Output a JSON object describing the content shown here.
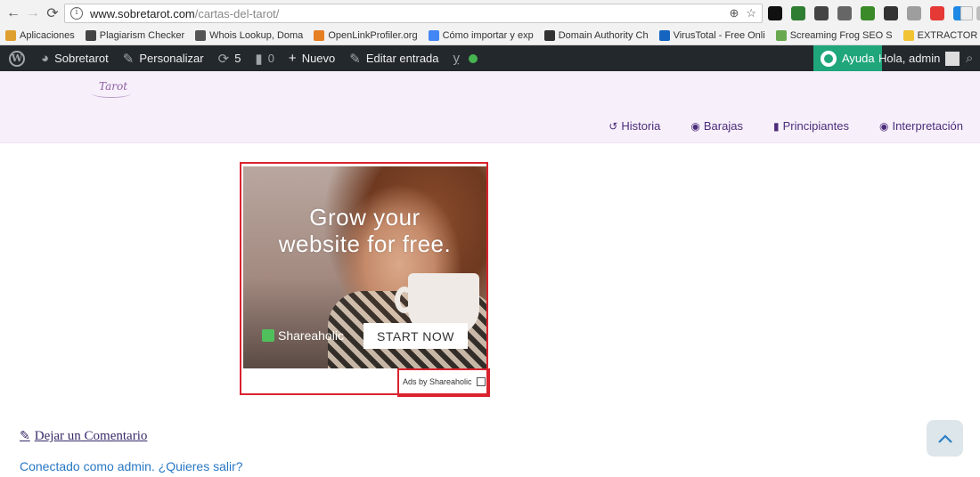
{
  "browser": {
    "url_host": "www.sobretarot.com",
    "url_path": "/cartas-del-tarot/",
    "extensions": [
      {
        "name": "ext-1",
        "color": "#111111"
      },
      {
        "name": "ext-2",
        "color": "#2e7d32"
      },
      {
        "name": "ext-3",
        "color": "#444444"
      },
      {
        "name": "ext-4",
        "color": "#666666"
      },
      {
        "name": "ext-5",
        "color": "#3b8a2a"
      },
      {
        "name": "ext-6",
        "color": "#333333"
      },
      {
        "name": "ext-7",
        "color": "#9e9e9e"
      },
      {
        "name": "ext-8",
        "color": "#e53935"
      },
      {
        "name": "ext-9",
        "color": "#1e88e5"
      },
      {
        "name": "ext-10",
        "color": "#bdbdbd"
      }
    ]
  },
  "bookmarks": [
    {
      "label": "Aplicaciones",
      "icon": "apps-icon",
      "color": "#e0a030"
    },
    {
      "label": "Plagiarism Checker",
      "icon": "plagiarism-icon",
      "color": "#444444"
    },
    {
      "label": "Whois Lookup, Doma",
      "icon": "whois-icon",
      "color": "#555555"
    },
    {
      "label": "OpenLinkProfiler.org",
      "icon": "openlink-icon",
      "color": "#e67e22"
    },
    {
      "label": "Cómo importar y exp",
      "icon": "google-icon",
      "color": "#4285f4"
    },
    {
      "label": "Domain Authority Ch",
      "icon": "domain-authority-icon",
      "color": "#333333"
    },
    {
      "label": "VirusTotal - Free Onli",
      "icon": "virustotal-icon",
      "color": "#1565c0"
    },
    {
      "label": "Screaming Frog SEO S",
      "icon": "frog-icon",
      "color": "#6aa84f"
    },
    {
      "label": "EXTRACTOR DE CORR",
      "icon": "warning-icon",
      "color": "#f1c232"
    }
  ],
  "adminbar": {
    "site": "Sobretarot",
    "customize": "Personalizar",
    "updates": "5",
    "comments": "0",
    "new": "Nuevo",
    "edit": "Editar entrada",
    "help": "Ayuda",
    "greeting": "Hola, admin"
  },
  "site": {
    "logo_text": "Tarot",
    "nav": [
      {
        "label": "Historia",
        "icon": "history-icon",
        "glyph": "↺"
      },
      {
        "label": "Barajas",
        "icon": "globe-icon",
        "glyph": "◉"
      },
      {
        "label": "Principiantes",
        "icon": "book-icon",
        "glyph": "▮"
      },
      {
        "label": "Interpretación",
        "icon": "eye-icon",
        "glyph": "◉"
      }
    ]
  },
  "ad": {
    "headline_1": "Grow your",
    "headline_2": "website for free.",
    "brand": "Shareaholic",
    "cta": "START NOW",
    "credit": "Ads by Shareaholic",
    "highlight_color": "#d9232e"
  },
  "comments": {
    "leave_comment": "Dejar un Comentario",
    "logged_in": "Conectado como admin. ¿Quieres salir?"
  }
}
